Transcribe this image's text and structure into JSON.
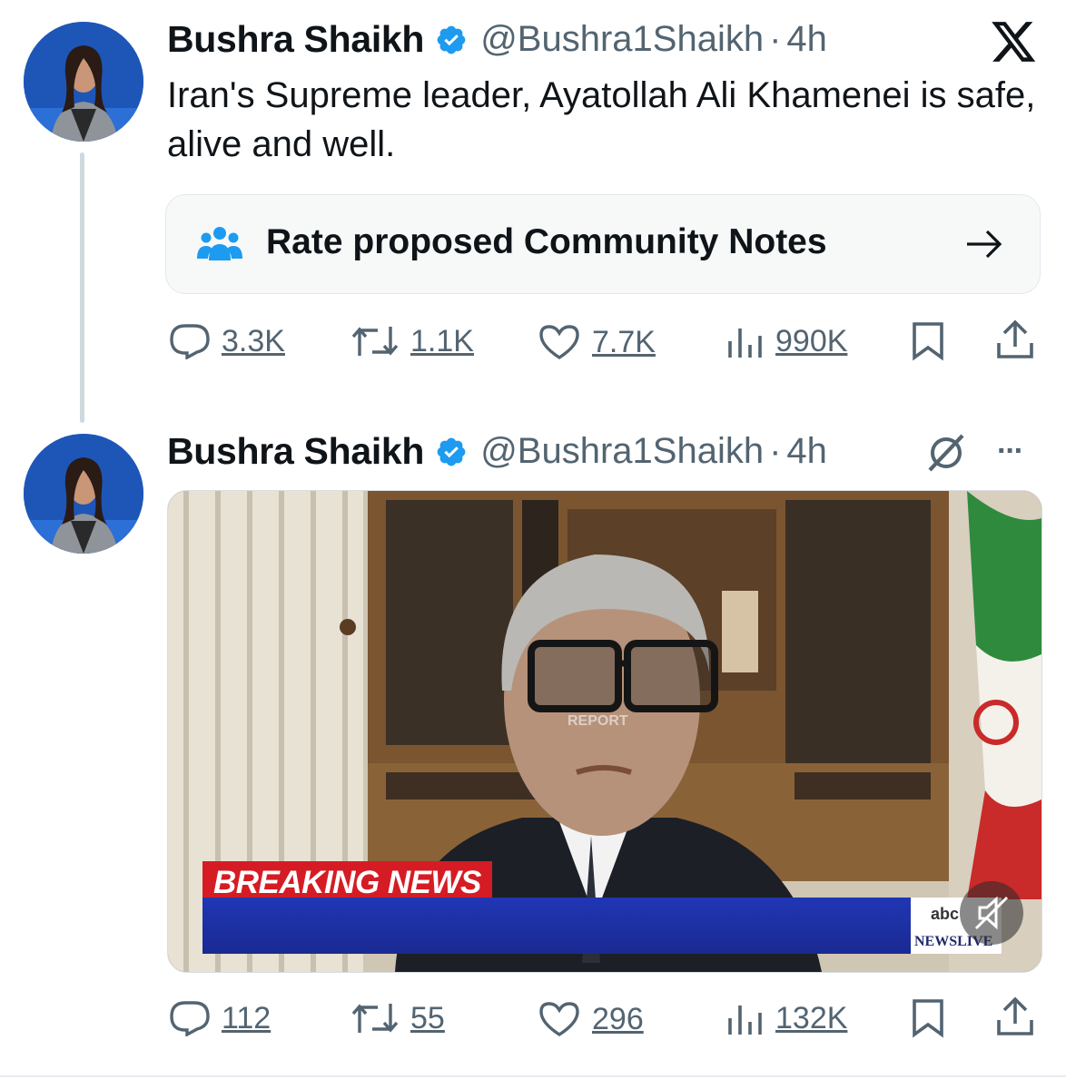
{
  "tweets": [
    {
      "author_name": "Bushra Shaikh",
      "handle": "@Bushra1Shaikh",
      "separator": "·",
      "time": "4h",
      "text": "Iran's Supreme leader, Ayatollah Ali Khamenei is safe, alive and well.",
      "community_notes_label": "Rate proposed Community Notes",
      "actions": {
        "replies": "3.3K",
        "reposts": "1.1K",
        "likes": "7.7K",
        "views": "990K"
      }
    },
    {
      "author_name": "Bushra Shaikh",
      "handle": "@Bushra1Shaikh",
      "separator": "·",
      "time": "4h",
      "more": "···",
      "video": {
        "banner": "BREAKING NEWS",
        "network_top": "abc",
        "network_bottom": "NEWSLIVE",
        "watermark": "REPORT"
      },
      "actions": {
        "replies": "112",
        "reposts": "55",
        "likes": "296",
        "views": "132K"
      }
    }
  ],
  "colors": {
    "text": "#0f1419",
    "secondary": "#536471",
    "verified": "#1d9bf0",
    "community_icon": "#1d9bf0",
    "breaking_red": "#d51c24",
    "news_blue": "#2036b4"
  },
  "icons": [
    "x-logo-icon",
    "verified-badge-icon",
    "community-notes-icon",
    "arrow-right-icon",
    "reply-icon",
    "repost-icon",
    "like-icon",
    "views-icon",
    "bookmark-icon",
    "share-icon",
    "grok-icon",
    "more-icon",
    "mute-icon"
  ]
}
